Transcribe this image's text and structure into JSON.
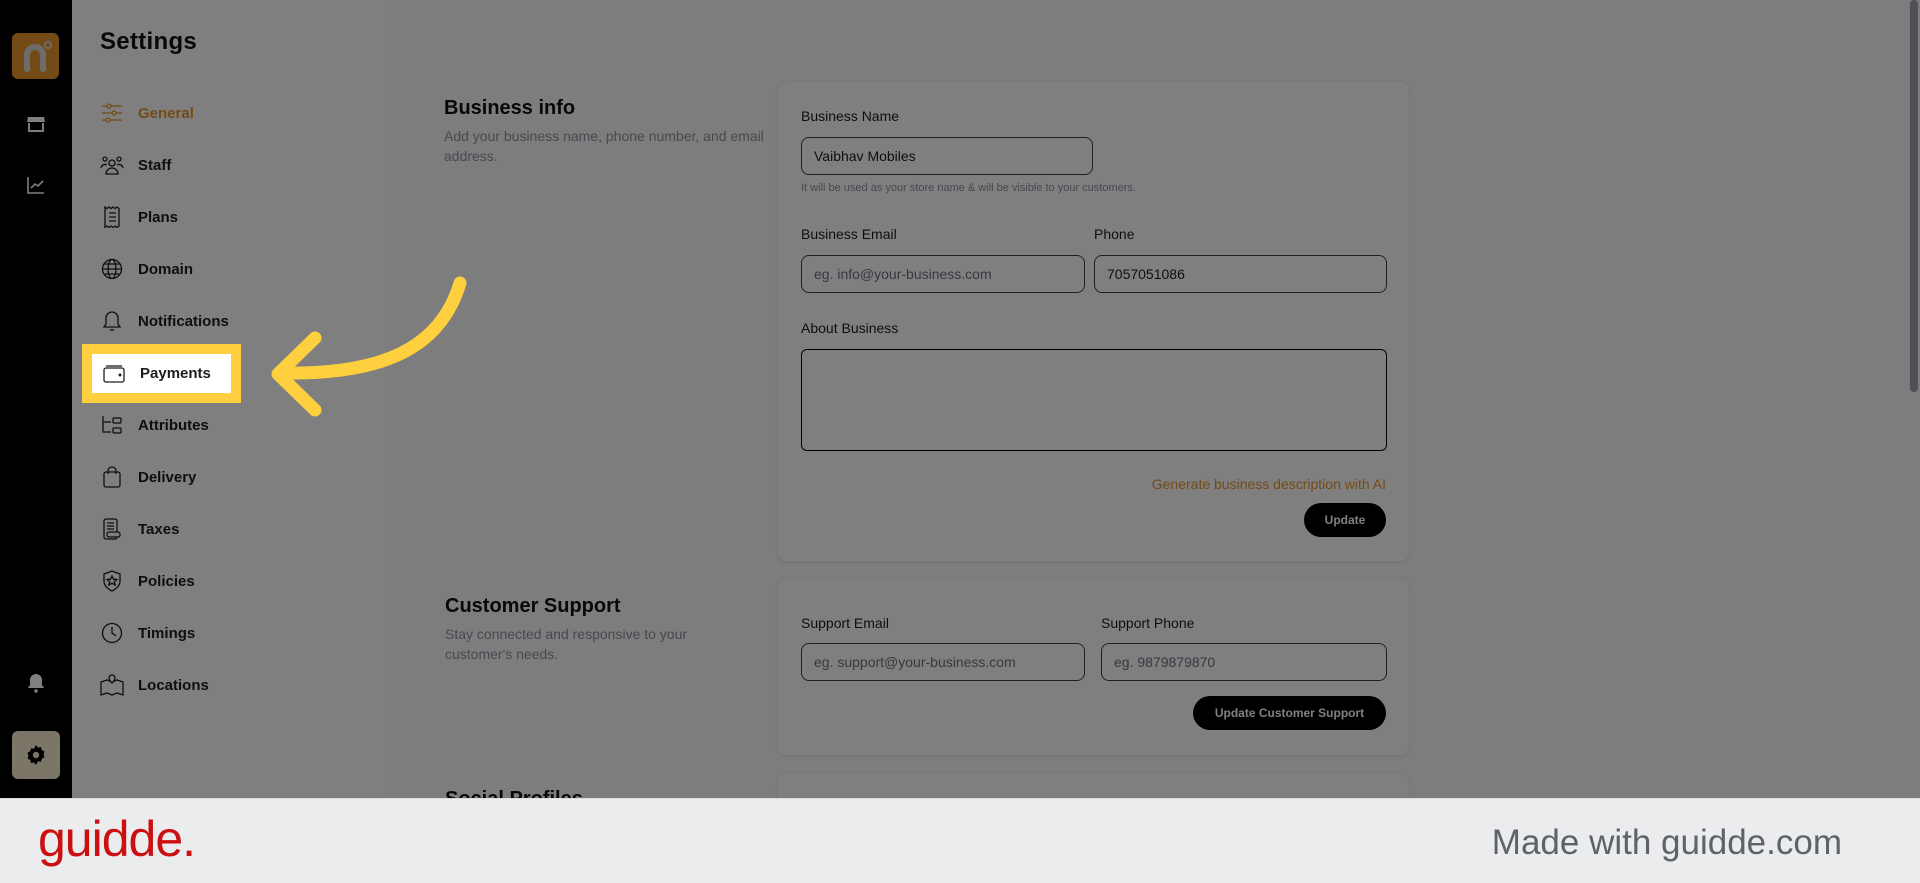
{
  "rail": {
    "logo_letter": "n",
    "icons": [
      "store-icon",
      "analytics-icon",
      "bell-icon",
      "gear-icon"
    ]
  },
  "nav": {
    "title": "Settings",
    "items": [
      {
        "label": "General",
        "icon": "sliders-icon",
        "active": true
      },
      {
        "label": "Staff",
        "icon": "users-icon"
      },
      {
        "label": "Plans",
        "icon": "receipt-icon"
      },
      {
        "label": "Domain",
        "icon": "globe-icon"
      },
      {
        "label": "Notifications",
        "icon": "bell-icon"
      },
      {
        "label": "Payments",
        "icon": "wallet-icon",
        "highlighted": true
      },
      {
        "label": "Attributes",
        "icon": "hierarchy-icon"
      },
      {
        "label": "Delivery",
        "icon": "bag-icon"
      },
      {
        "label": "Taxes",
        "icon": "tax-icon"
      },
      {
        "label": "Policies",
        "icon": "shield-star-icon"
      },
      {
        "label": "Timings",
        "icon": "clock-icon"
      },
      {
        "label": "Locations",
        "icon": "map-icon"
      }
    ]
  },
  "business_info": {
    "title": "Business info",
    "description": "Add your business name, phone number, and email address.",
    "name_label": "Business Name",
    "name_value": "Vaibhav Mobiles",
    "name_hint": "It will be used as your store name & will be visible to your customers.",
    "email_label": "Business Email",
    "email_placeholder": "eg. info@your-business.com",
    "phone_label": "Phone",
    "phone_value": "7057051086",
    "about_label": "About Business",
    "about_value": "",
    "ai_link": "Generate business description with AI",
    "update_button": "Update"
  },
  "customer_support": {
    "title": "Customer Support",
    "description": "Stay connected and responsive to your customer's needs.",
    "email_label": "Support Email",
    "email_placeholder": "eg. support@your-business.com",
    "phone_label": "Support Phone",
    "phone_placeholder": "eg. 9879879870",
    "update_button": "Update Customer Support"
  },
  "social_profiles": {
    "title": "Social Profiles"
  },
  "colors": {
    "accent": "#e8962d",
    "highlight": "#fecf3e",
    "brand_red": "#cc0f10"
  },
  "footer": {
    "brand": "guidde.",
    "made_with": "Made with guidde.com"
  }
}
